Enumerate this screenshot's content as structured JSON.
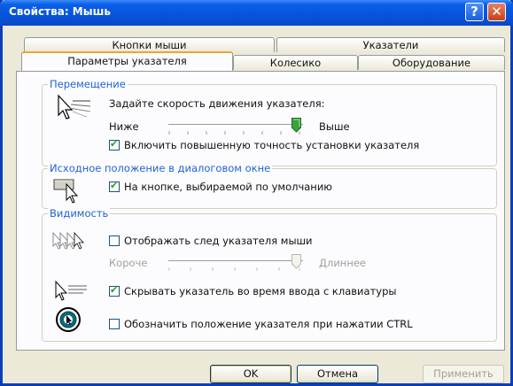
{
  "window": {
    "title": "Свойства: Мышь"
  },
  "titlebar": {
    "help_label": "?",
    "close_label": "✕"
  },
  "tabs": {
    "back": [
      "Кнопки мыши",
      "Указатели"
    ],
    "front": [
      "Параметры указателя",
      "Колесико",
      "Оборудование"
    ],
    "active": "Параметры указателя"
  },
  "motion": {
    "group_label": "Перемещение",
    "prompt": "Задайте скорость движения указателя:",
    "slow_label": "Ниже",
    "fast_label": "Выше",
    "speed_level": 0.95,
    "precision_label": "Включить повышенную точность установки указателя",
    "precision_checked": true
  },
  "snap_to": {
    "group_label": "Исходное положение в диалоговом окне",
    "option_label": "На кнопке, выбираемой по умолчанию",
    "checked": true
  },
  "visibility": {
    "group_label": "Видимость",
    "trails_label": "Отображать след указателя мыши",
    "trails_checked": false,
    "short_label": "Короче",
    "long_label": "Длиннее",
    "trail_level": 0.95,
    "hide_label": "Скрывать указатель во время ввода с клавиатуры",
    "hide_checked": true,
    "ctrl_label": "Обозначить положение указателя при нажатии CTRL",
    "ctrl_checked": false
  },
  "buttons": {
    "ok": "OK",
    "cancel": "Отмена",
    "apply": "Применить"
  },
  "colors": {
    "title_bar": "#0a5ee6",
    "group_label": "#1f62d8",
    "face": "#ece9d8"
  }
}
